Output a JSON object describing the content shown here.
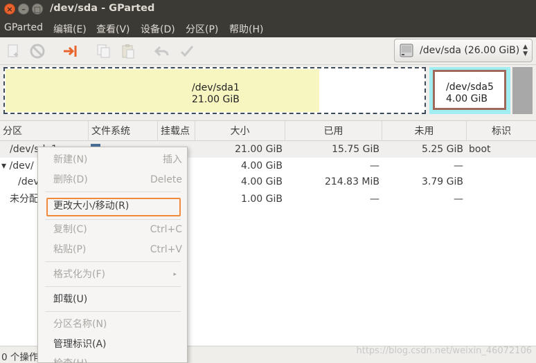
{
  "window": {
    "title": "/dev/sda - GParted",
    "buttons": {
      "close": "×",
      "minimize": "–",
      "maximize": "□"
    }
  },
  "menubar": [
    "GParted",
    "编辑(E)",
    "查看(V)",
    "设备(D)",
    "分区(P)",
    "帮助(H)"
  ],
  "toolbar": {
    "icons": [
      "new-partition-icon",
      "delete-icon",
      "resize-move-icon",
      "copy-icon",
      "paste-icon",
      "undo-icon",
      "apply-icon"
    ],
    "device_label": "/dev/sda   (26.00 GiB)"
  },
  "diskmap": {
    "partition1": {
      "name": "/dev/sda1",
      "size": "21.00 GiB",
      "used_fraction": 0.75
    },
    "logical": {
      "name": "/dev/sda5",
      "size": "4.00 GiB"
    }
  },
  "table": {
    "headers": [
      "分区",
      "文件系统",
      "挂载点",
      "大小",
      "已用",
      "未用",
      "标识"
    ],
    "rows": [
      {
        "partition": "/dev/sda1",
        "size": "21.00 GiB",
        "used": "15.75 GiB",
        "unused": "5.25 GiB",
        "flags": "boot"
      },
      {
        "partition": "▾ /dev/",
        "size": "4.00 GiB",
        "used": "—",
        "unused": "—",
        "flags": ""
      },
      {
        "partition": "/dev",
        "size": "4.00 GiB",
        "used": "214.83 MiB",
        "unused": "3.79 GiB",
        "flags": ""
      },
      {
        "partition": "未分配",
        "size": "1.00 GiB",
        "used": "—",
        "unused": "—",
        "flags": ""
      }
    ]
  },
  "context_menu": {
    "new": {
      "label": "新建(N)",
      "accel": "插入"
    },
    "delete": {
      "label": "删除(D)",
      "accel": "Delete"
    },
    "resize": {
      "label": "更改大小/移动(R)"
    },
    "copy": {
      "label": "复制(C)",
      "accel": "Ctrl+C"
    },
    "paste": {
      "label": "粘贴(P)",
      "accel": "Ctrl+V"
    },
    "format": {
      "label": "格式化为(F)",
      "arrow": "▸"
    },
    "unmount": {
      "label": "卸载(U)"
    },
    "name": {
      "label": "分区名称(N)"
    },
    "flags": {
      "label": "管理标识(A)"
    },
    "check": {
      "label": "检查(H)"
    }
  },
  "statusbar": {
    "text": "0 个操作"
  },
  "watermark": "https://blog.csdn.net/weixin_46072106"
}
